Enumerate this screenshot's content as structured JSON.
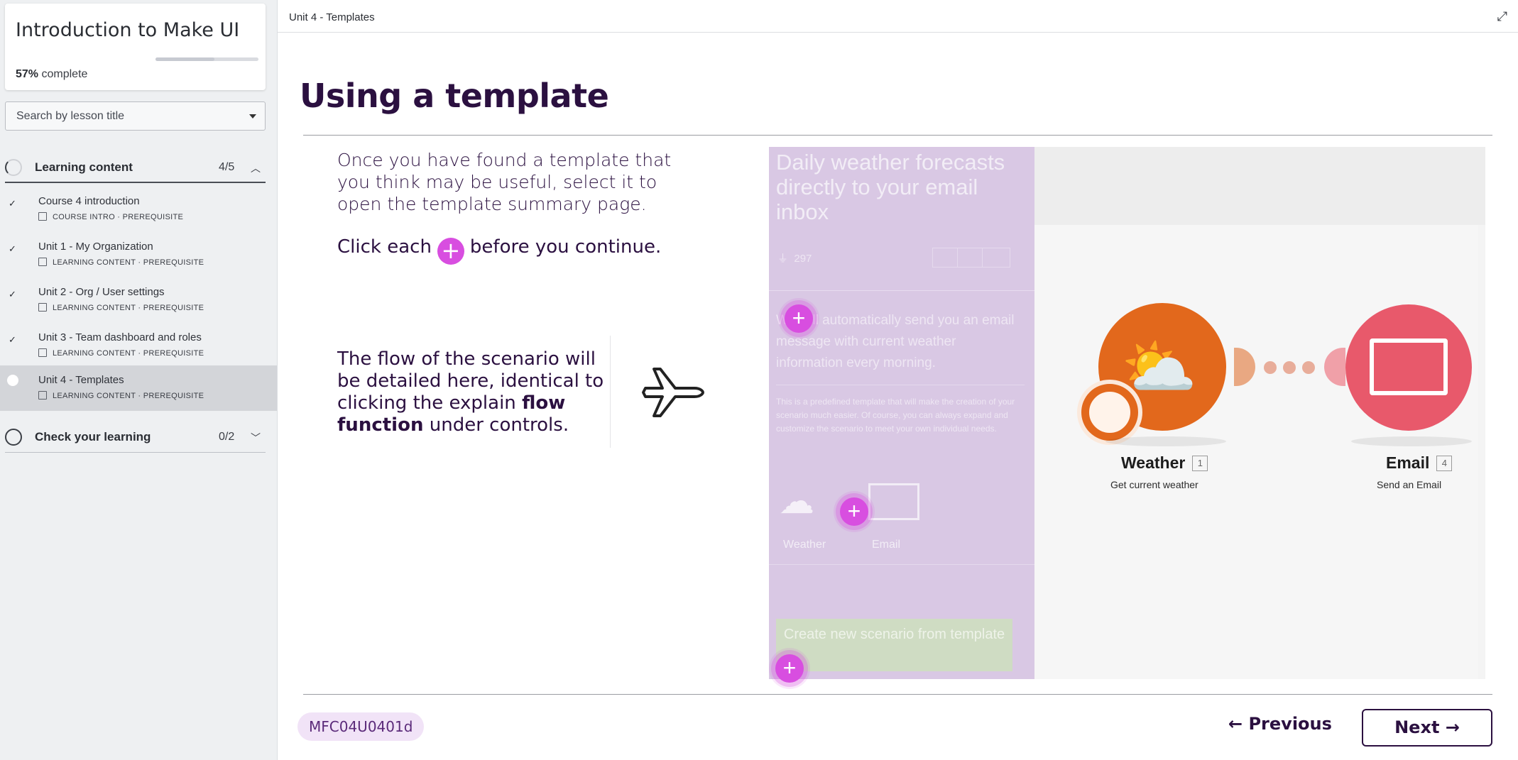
{
  "sidebar": {
    "course_title": "Introduction to Make UI",
    "progress_pct": "57%",
    "progress_suffix": "complete",
    "progress_value": 0.57,
    "search_placeholder": "Search by lesson title",
    "sections": [
      {
        "label": "Learning content",
        "count": "4/5",
        "expanded": true,
        "lessons": [
          {
            "title": "Course 4 introduction",
            "meta": "COURSE INTRO · PREREQUISITE",
            "done": true
          },
          {
            "title": "Unit 1 - My Organization",
            "meta": "LEARNING CONTENT · PREREQUISITE",
            "done": true
          },
          {
            "title": "Unit 2 - Org / User settings",
            "meta": "LEARNING CONTENT · PREREQUISITE",
            "done": true
          },
          {
            "title": "Unit 3 - Team dashboard and roles",
            "meta": "LEARNING CONTENT · PREREQUISITE",
            "done": true
          },
          {
            "title": "Unit 4 - Templates",
            "meta": "LEARNING CONTENT · PREREQUISITE",
            "done": false,
            "active": true
          }
        ]
      },
      {
        "label": "Check your learning",
        "count": "0/2",
        "expanded": false
      }
    ]
  },
  "main": {
    "breadcrumb": "Unit 4 - Templates",
    "heading": "Using a template",
    "para1": "Once you have found a template that you think may be useful, select it to open the template summary page.",
    "click_prefix": "Click each",
    "click_suffix": "before you continue.",
    "flow_part1": "The flow of the scenario will be detailed here, identical to clicking the explain ",
    "flow_bold": "flow function",
    "flow_part2": " under controls.",
    "illustration": {
      "panel_title": "Daily weather forecasts directly to your email inbox",
      "likes": "297",
      "description": "We will automatically send you an email message with current weather information every morning.",
      "small_text": "This is a predefined template that will make the creation of your scenario much easier. Of course, you can always expand and customize the scenario to meet your own individual needs.",
      "app_weather": "Weather",
      "app_email": "Email",
      "cta": "Create new scenario from template",
      "node1_name": "Weather",
      "node1_num": "1",
      "node1_sub": "Get current weather",
      "node2_name": "Email",
      "node2_num": "4",
      "node2_sub": "Send an Email"
    },
    "lesson_code": "MFC04U0401d",
    "prev_label": "Previous",
    "next_label": "Next",
    "colors": {
      "accent": "#d84ee0",
      "heading": "#2b1040",
      "weather": "#e2681c",
      "email": "#e8596b"
    }
  }
}
